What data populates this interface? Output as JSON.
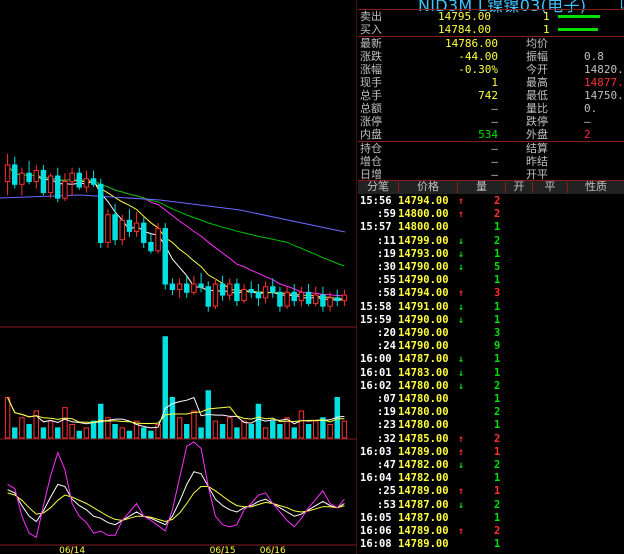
{
  "colors": {
    "up": "#ff3030",
    "down": "#00e0e0",
    "label": "#c0c0c0",
    "green": "#00e000",
    "yellow": "#ffff40",
    "cyan": "#20d0ff",
    "magenta": "#ff30ff",
    "grid": "#8a1c1c"
  },
  "header": {
    "title": "NID3M L镍镍03(电子)",
    "title_right": "["
  },
  "orderbook": [
    {
      "label": "卖出",
      "price": "14795.00",
      "qty": "1",
      "bar_frac": 1.0
    },
    {
      "label": "买入",
      "price": "14784.00",
      "qty": "1",
      "bar_frac": 0.95
    }
  ],
  "stats_left": [
    {
      "label": "最新",
      "value": "14786.00",
      "color": "yellow"
    },
    {
      "label": "涨跌",
      "value": "-44.00",
      "color": "yellow"
    },
    {
      "label": "涨幅",
      "value": "-0.30%",
      "color": "yellow"
    },
    {
      "label": "现手",
      "value": "1",
      "color": "yellow"
    },
    {
      "label": "总手",
      "value": "742",
      "color": "yellow"
    },
    {
      "label": "总额",
      "value": "—",
      "color": "label"
    },
    {
      "label": "涨停",
      "value": "—",
      "color": "label"
    },
    {
      "label": "内盘",
      "value": "534",
      "color": "green"
    },
    {
      "label": "持仓",
      "value": "—",
      "color": "label"
    },
    {
      "label": "增仓",
      "value": "—",
      "color": "label"
    },
    {
      "label": "日增",
      "value": "—",
      "color": "label"
    }
  ],
  "stats_right": [
    {
      "label": "均价",
      "value": "",
      "color": "label"
    },
    {
      "label": "振幅",
      "value": "0.8",
      "color": "label"
    },
    {
      "label": "今开",
      "value": "14820.",
      "color": "label"
    },
    {
      "label": "最高",
      "value": "14877.",
      "color": "up"
    },
    {
      "label": "最低",
      "value": "14750.",
      "color": "label"
    },
    {
      "label": "量比",
      "value": "0.",
      "color": "label"
    },
    {
      "label": "跌停",
      "value": "—",
      "color": "label"
    },
    {
      "label": "外盘",
      "value": "2",
      "color": "up"
    },
    {
      "label": "结算",
      "value": "",
      "color": "label"
    },
    {
      "label": "昨结",
      "value": "",
      "color": "label"
    },
    {
      "label": "开平",
      "value": "",
      "color": "label"
    }
  ],
  "tick_headers": [
    "分笔",
    "价格",
    "量",
    "开",
    "平",
    "性质"
  ],
  "ticks": [
    {
      "time": "15:56",
      "price": "14794.00",
      "dir": "up",
      "vol": "2"
    },
    {
      "time": ":59",
      "price": "14800.00",
      "dir": "up",
      "vol": "2"
    },
    {
      "time": "15:57",
      "price": "14800.00",
      "dir": "",
      "vol": "1"
    },
    {
      "time": ":11",
      "price": "14799.00",
      "dir": "down",
      "vol": "2"
    },
    {
      "time": ":19",
      "price": "14793.00",
      "dir": "down",
      "vol": "1"
    },
    {
      "time": ":30",
      "price": "14790.00",
      "dir": "down",
      "vol": "5"
    },
    {
      "time": ":55",
      "price": "14790.00",
      "dir": "",
      "vol": "1"
    },
    {
      "time": ":58",
      "price": "14794.00",
      "dir": "up",
      "vol": "3"
    },
    {
      "time": "15:58",
      "price": "14791.00",
      "dir": "down",
      "vol": "1"
    },
    {
      "time": "15:59",
      "price": "14790.00",
      "dir": "down",
      "vol": "1"
    },
    {
      "time": ":20",
      "price": "14790.00",
      "dir": "",
      "vol": "3"
    },
    {
      "time": ":24",
      "price": "14790.00",
      "dir": "",
      "vol": "9"
    },
    {
      "time": "16:00",
      "price": "14787.00",
      "dir": "down",
      "vol": "1"
    },
    {
      "time": "16:01",
      "price": "14783.00",
      "dir": "down",
      "vol": "1"
    },
    {
      "time": "16:02",
      "price": "14780.00",
      "dir": "down",
      "vol": "2"
    },
    {
      "time": ":07",
      "price": "14780.00",
      "dir": "",
      "vol": "1"
    },
    {
      "time": ":19",
      "price": "14780.00",
      "dir": "",
      "vol": "2"
    },
    {
      "time": ":23",
      "price": "14780.00",
      "dir": "",
      "vol": "1"
    },
    {
      "time": ":32",
      "price": "14785.00",
      "dir": "up",
      "vol": "2"
    },
    {
      "time": "16:03",
      "price": "14789.00",
      "dir": "up",
      "vol": "1"
    },
    {
      "time": ":47",
      "price": "14782.00",
      "dir": "down",
      "vol": "2"
    },
    {
      "time": "16:04",
      "price": "14782.00",
      "dir": "",
      "vol": "1"
    },
    {
      "time": ":25",
      "price": "14789.00",
      "dir": "up",
      "vol": "1"
    },
    {
      "time": ":53",
      "price": "14787.00",
      "dir": "down",
      "vol": "2"
    },
    {
      "time": "16:05",
      "price": "14787.00",
      "dir": "",
      "vol": "1"
    },
    {
      "time": "16:06",
      "price": "14789.00",
      "dir": "up",
      "vol": "2"
    },
    {
      "time": "16:08",
      "price": "14789.00",
      "dir": "",
      "vol": "1"
    }
  ],
  "chart": {
    "candles": [
      [
        14860,
        14880,
        14850,
        14872
      ],
      [
        14872,
        14878,
        14855,
        14858
      ],
      [
        14858,
        14870,
        14850,
        14866
      ],
      [
        14866,
        14875,
        14858,
        14860
      ],
      [
        14860,
        14872,
        14855,
        14868
      ],
      [
        14868,
        14872,
        14850,
        14852
      ],
      [
        14852,
        14866,
        14848,
        14864
      ],
      [
        14864,
        14870,
        14845,
        14848
      ],
      [
        14848,
        14866,
        14846,
        14860
      ],
      [
        14860,
        14870,
        14850,
        14866
      ],
      [
        14866,
        14870,
        14854,
        14856
      ],
      [
        14856,
        14868,
        14852,
        14862
      ],
      [
        14862,
        14868,
        14856,
        14858
      ],
      [
        14858,
        14862,
        14812,
        14816
      ],
      [
        14816,
        14840,
        14812,
        14836
      ],
      [
        14836,
        14844,
        14814,
        14818
      ],
      [
        14818,
        14836,
        14814,
        14832
      ],
      [
        14832,
        14840,
        14820,
        14824
      ],
      [
        14824,
        14838,
        14820,
        14830
      ],
      [
        14830,
        14834,
        14812,
        14816
      ],
      [
        14816,
        14822,
        14808,
        14810
      ],
      [
        14810,
        14830,
        14808,
        14826
      ],
      [
        14826,
        14830,
        14782,
        14786
      ],
      [
        14786,
        14790,
        14778,
        14782
      ],
      [
        14782,
        14790,
        14776,
        14786
      ],
      [
        14786,
        14792,
        14776,
        14780
      ],
      [
        14780,
        14792,
        14778,
        14786
      ],
      [
        14786,
        14794,
        14780,
        14784
      ],
      [
        14784,
        14788,
        14766,
        14770
      ],
      [
        14770,
        14790,
        14768,
        14786
      ],
      [
        14786,
        14792,
        14774,
        14778
      ],
      [
        14778,
        14790,
        14774,
        14786
      ],
      [
        14786,
        14790,
        14770,
        14774
      ],
      [
        14774,
        14786,
        14772,
        14782
      ],
      [
        14782,
        14788,
        14776,
        14780
      ],
      [
        14780,
        14786,
        14770,
        14776
      ],
      [
        14776,
        14788,
        14772,
        14784
      ],
      [
        14784,
        14790,
        14776,
        14780
      ],
      [
        14780,
        14784,
        14766,
        14770
      ],
      [
        14770,
        14784,
        14768,
        14780
      ],
      [
        14780,
        14786,
        14770,
        14774
      ],
      [
        14774,
        14784,
        14770,
        14780
      ],
      [
        14780,
        14786,
        14770,
        14772
      ],
      [
        14772,
        14784,
        14770,
        14778
      ],
      [
        14778,
        14784,
        14766,
        14770
      ],
      [
        14770,
        14780,
        14766,
        14776
      ],
      [
        14776,
        14782,
        14770,
        14774
      ],
      [
        14774,
        14782,
        14770,
        14778
      ]
    ],
    "volumes": [
      12,
      3,
      6,
      4,
      8,
      3,
      5,
      3,
      9,
      4,
      2,
      3,
      5,
      10,
      6,
      4,
      3,
      2,
      5,
      3,
      2,
      4,
      30,
      12,
      6,
      4,
      8,
      3,
      14,
      5,
      4,
      6,
      3,
      5,
      4,
      10,
      3,
      5,
      4,
      6,
      3,
      8,
      4,
      5,
      6,
      4,
      12,
      5
    ],
    "price_range": [
      14760,
      14890
    ],
    "volume_max": 32,
    "kd_k": [
      55,
      52,
      40,
      30,
      25,
      35,
      48,
      60,
      58,
      46,
      40,
      36,
      30,
      28,
      24,
      22,
      26,
      30,
      34,
      30,
      28,
      25,
      22,
      30,
      44,
      60,
      72,
      70,
      58,
      46,
      40,
      36,
      34,
      38,
      40,
      44,
      46,
      42,
      38,
      34,
      30,
      32,
      36,
      40,
      44,
      40,
      38,
      42
    ],
    "kd_d": [
      52,
      50,
      45,
      38,
      32,
      33,
      38,
      45,
      50,
      48,
      45,
      42,
      38,
      34,
      30,
      27,
      26,
      28,
      30,
      30,
      29,
      27,
      25,
      27,
      33,
      42,
      52,
      58,
      58,
      54,
      49,
      44,
      40,
      39,
      39,
      41,
      43,
      42,
      40,
      38,
      35,
      34,
      35,
      37,
      39,
      39,
      38,
      40
    ],
    "kd_j": [
      60,
      56,
      30,
      14,
      10,
      40,
      68,
      90,
      74,
      42,
      30,
      24,
      14,
      16,
      12,
      12,
      26,
      34,
      42,
      30,
      26,
      21,
      16,
      36,
      66,
      96,
      100,
      94,
      58,
      30,
      22,
      20,
      22,
      36,
      42,
      50,
      52,
      42,
      34,
      26,
      20,
      28,
      38,
      46,
      54,
      42,
      38,
      46
    ],
    "x_labels": [
      "06/14",
      "06/15",
      "06/16"
    ],
    "x_label_idx": [
      9,
      30,
      37
    ]
  }
}
